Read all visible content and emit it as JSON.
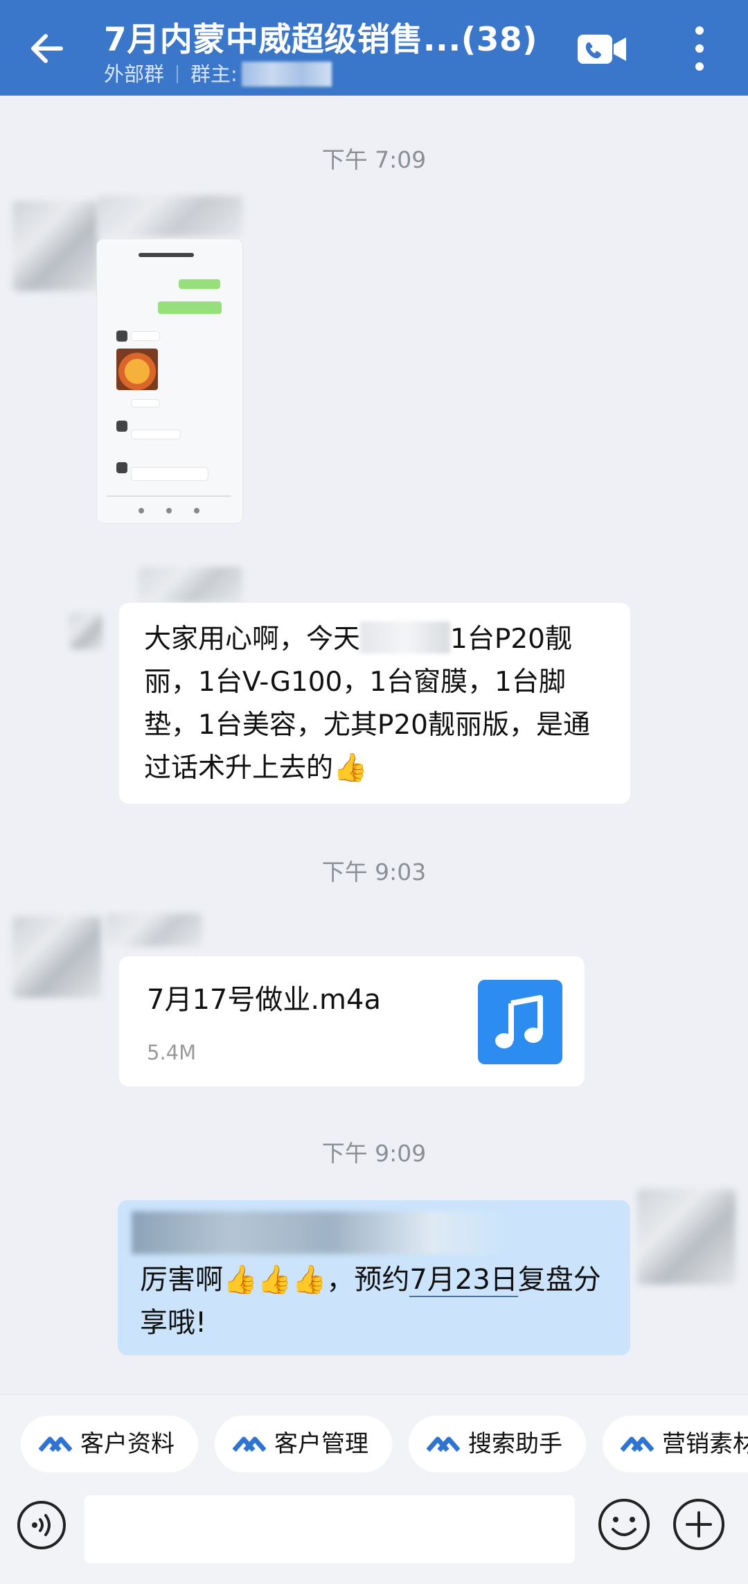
{
  "header": {
    "title": "7月内蒙中威超级销售...(38)",
    "group_type": "外部群",
    "owner_label": "群主:"
  },
  "messages": [
    {
      "type": "time",
      "text": "下午 7:09"
    },
    {
      "type": "image",
      "sender": "other"
    },
    {
      "type": "text",
      "sender": "other",
      "parts": [
        "大家用心啊，今天",
        "1台P20靓丽，1台V-G100，1台窗膜，1台脚垫，1台美容，尤其P20靓丽版，是通过话术升上去的",
        "👍"
      ]
    },
    {
      "type": "time",
      "text": "下午 9:03"
    },
    {
      "type": "file",
      "sender": "other",
      "file_name": "7月17号做业.m4a",
      "file_size": "5.4M"
    },
    {
      "type": "time",
      "text": "下午 9:09"
    },
    {
      "type": "text",
      "sender": "self",
      "parts": [
        "厉害啊",
        "👍👍👍",
        "，预约",
        "7月23日",
        "复盘分享哦!"
      ]
    }
  ],
  "toolbar": {
    "chips": [
      "客户资料",
      "客户管理",
      "搜索助手",
      "营销素材"
    ]
  },
  "colors": {
    "header_bg": "#3a76c9",
    "own_bubble": "#cbe4fb",
    "music_icon": "#2d8cf0"
  }
}
